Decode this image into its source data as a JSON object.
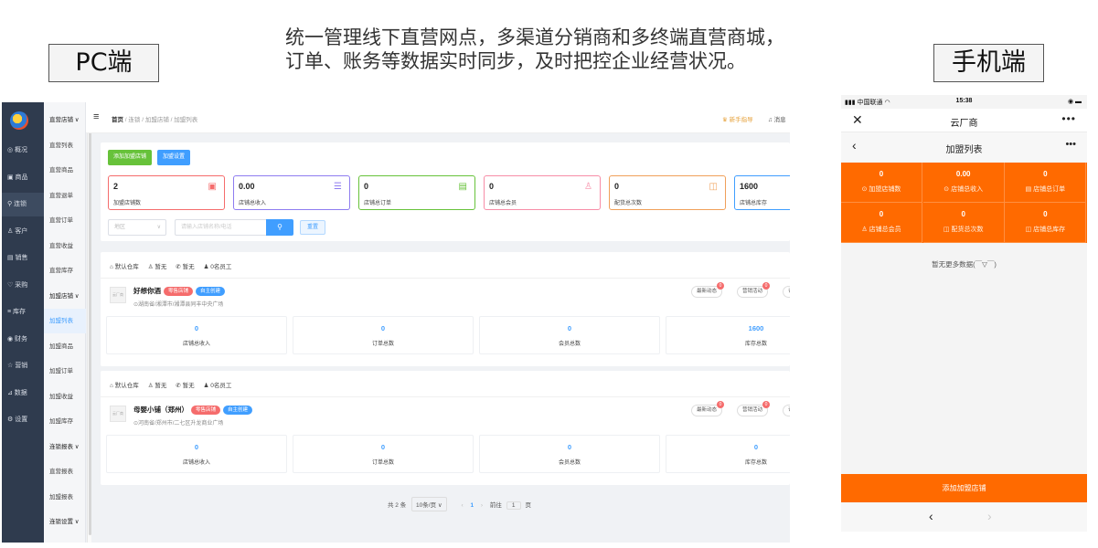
{
  "headline": {
    "line1": "统一管理线下直营网点，多渠道分销商和多终端直营商城，",
    "line2": "订单、账务等数据实时同步，及时把控企业经营状况。"
  },
  "labels": {
    "pc": "PC端",
    "mobile": "手机端"
  },
  "pc": {
    "sidebar_main": [
      {
        "label": "◎ 概况"
      },
      {
        "label": "▣ 商品"
      },
      {
        "label": "⚲ 连锁"
      },
      {
        "label": "♙ 客户"
      },
      {
        "label": "▤ 销售"
      },
      {
        "label": "♡ 采购"
      },
      {
        "label": "≡ 库存"
      },
      {
        "label": "◉ 财务"
      },
      {
        "label": "☆ 营销"
      },
      {
        "label": "⊿ 数据"
      },
      {
        "label": "⚙ 设置"
      }
    ],
    "sidebar_sub": [
      {
        "label": "直营店铺 ∨"
      },
      {
        "label": "直营列表"
      },
      {
        "label": "直营商品"
      },
      {
        "label": "直营退单"
      },
      {
        "label": "直营订单"
      },
      {
        "label": "直营收益"
      },
      {
        "label": "直营库存"
      },
      {
        "label": "加盟店铺 ∨"
      },
      {
        "label": "加盟列表"
      },
      {
        "label": "加盟商品"
      },
      {
        "label": "加盟订单"
      },
      {
        "label": "加盟收益"
      },
      {
        "label": "加盟库存"
      },
      {
        "label": "连锁报表 ∨"
      },
      {
        "label": "直营报表"
      },
      {
        "label": "加盟报表"
      },
      {
        "label": "连锁设置 ∨"
      }
    ],
    "breadcrumb": {
      "home": "首页",
      "rest": " / 连锁 / 加盟店铺 / 加盟列表"
    },
    "topbar": {
      "guide": "♛ 新手指导",
      "msg": "♫ 消息"
    },
    "buttons": {
      "add": "添加加盟店铺",
      "settings": "加盟设置"
    },
    "stats": [
      {
        "value": "2",
        "label": "加盟店铺数",
        "color": "#f56c6c",
        "icon": "▣"
      },
      {
        "value": "0.00",
        "label": "店铺总收入",
        "color": "#8e7cf0",
        "icon": "☰"
      },
      {
        "value": "0",
        "label": "店铺总订单",
        "color": "#67c23a",
        "icon": "▤"
      },
      {
        "value": "0",
        "label": "店铺总会员",
        "color": "#f78da7",
        "icon": "♙"
      },
      {
        "value": "0",
        "label": "配货总次数",
        "color": "#f0a05a",
        "icon": "◫"
      },
      {
        "value": "1600",
        "label": "店铺总库存",
        "color": "#409eff",
        "icon": ""
      }
    ],
    "filter": {
      "select": "地区",
      "search_placeholder": "请输入店铺名称/电话",
      "search_icon": "⚲",
      "reset": "重置"
    },
    "stores": [
      {
        "meta": [
          "⌂ 默认仓库",
          "♙ 暂无",
          "✆ 暂无",
          "♟ 0名员工"
        ],
        "thumb": "云厂商",
        "name": "好想你酒",
        "badge1": "零售店铺",
        "badge2": "自主创建",
        "addr": "⊙湖南省/湘潭市/湘潭县同丰中央广场",
        "acts": [
          {
            "label": "最新动态",
            "count": "0"
          },
          {
            "label": "营销活动",
            "count": "0"
          },
          {
            "label": "订货",
            "count": ""
          }
        ],
        "cells": [
          {
            "value": "0",
            "label": "店铺总收入"
          },
          {
            "value": "0",
            "label": "订单总数"
          },
          {
            "value": "0",
            "label": "会员总数"
          },
          {
            "value": "1600",
            "label": "库存总数"
          }
        ]
      },
      {
        "meta": [
          "⌂ 默认仓库",
          "♙ 暂无",
          "✆ 暂无",
          "♟ 0名员工"
        ],
        "thumb": "云厂商",
        "name": "母婴小铺（郑州）",
        "badge1": "零售店铺",
        "badge2": "自主创建",
        "addr": "⊙河南省/郑州市/二七区升龙商业广场",
        "acts": [
          {
            "label": "最新动态",
            "count": "0"
          },
          {
            "label": "营销活动",
            "count": "0"
          },
          {
            "label": "订货",
            "count": ""
          }
        ],
        "cells": [
          {
            "value": "0",
            "label": "店铺总收入"
          },
          {
            "value": "0",
            "label": "订单总数"
          },
          {
            "value": "0",
            "label": "会员总数"
          },
          {
            "value": "0",
            "label": "库存总数"
          }
        ]
      }
    ],
    "pager": {
      "total": "共 2 条",
      "size": "10条/页 ∨",
      "prev": "‹",
      "page": "1",
      "next": "›",
      "goto": "前往",
      "goto_value": "1",
      "page_unit": "页"
    }
  },
  "mobile": {
    "status": {
      "carrier": "▮▮▮ 中国联通 ◠",
      "time": "15:38",
      "battery": "◉ ▬"
    },
    "nav": {
      "close": "✕",
      "title": "云厂商",
      "more": "•••"
    },
    "sub": {
      "back": "‹",
      "title": "加盟列表",
      "more": "•••"
    },
    "grid": [
      {
        "value": "0",
        "label": "⊙ 加盟店铺数"
      },
      {
        "value": "0.00",
        "label": "⊙ 店铺总收入"
      },
      {
        "value": "0",
        "label": "▤ 店铺总订单"
      },
      {
        "value": "0",
        "label": "♙ 店铺总会员"
      },
      {
        "value": "0",
        "label": "◫ 配货总次数"
      },
      {
        "value": "0",
        "label": "◫ 店铺总库存"
      }
    ],
    "empty": "暂无更多数据(￣▽￣)",
    "add_button": "添加加盟店铺",
    "bottom": {
      "back": "‹",
      "forward": "›"
    }
  }
}
